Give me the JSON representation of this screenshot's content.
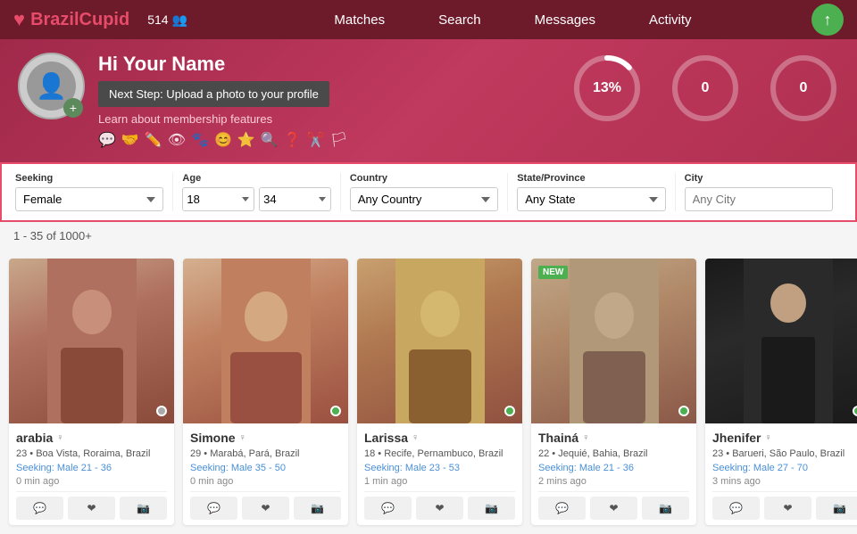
{
  "header": {
    "logo_brazil": "Brazil",
    "logo_cupid": "Cupid",
    "notifications": "514",
    "nav": {
      "matches": "Matches",
      "search": "Search",
      "messages": "Messages",
      "activity": "Activity"
    }
  },
  "profile": {
    "greeting": "Hi Your Name",
    "next_step": "Next Step: Upload a photo to your profile",
    "membership_link": "Learn about membership features",
    "stats": {
      "percent": "13%",
      "matches": "0",
      "messages": "0"
    }
  },
  "filters": {
    "seeking_label": "Seeking",
    "seeking_value": "Female",
    "age_label": "Age",
    "age_min": "18",
    "age_max": "34",
    "country_label": "Country",
    "country_value": "Any Country",
    "state_label": "State/Province",
    "state_value": "Any State",
    "city_label": "City",
    "city_value": "Any City"
  },
  "results": {
    "count_label": "1 - 35 of 1000+"
  },
  "cards": [
    {
      "name": "arabia",
      "age": "23",
      "location": "Boa Vista, Roraima, Brazil",
      "seeking": "Seeking: Male 21 - 36",
      "time": "0 min ago",
      "online": false,
      "new": false
    },
    {
      "name": "Simone",
      "age": "29",
      "location": "Marabá, Pará, Brazil",
      "seeking": "Seeking: Male 35 - 50",
      "time": "0 min ago",
      "online": true,
      "new": false
    },
    {
      "name": "Larissa",
      "age": "18",
      "location": "Recife, Pernambuco, Brazil",
      "seeking": "Seeking: Male 23 - 53",
      "time": "1 min ago",
      "online": true,
      "new": false
    },
    {
      "name": "Thainá",
      "age": "22",
      "location": "Jequié, Bahia, Brazil",
      "seeking": "Seeking: Male 21 - 36",
      "time": "2 mins ago",
      "online": true,
      "new": true
    },
    {
      "name": "Jhenifer",
      "age": "23",
      "location": "Barueri, São Paulo, Brazil",
      "seeking": "Seeking: Male 27 - 70",
      "time": "3 mins ago",
      "online": true,
      "new": false
    }
  ],
  "icons": {
    "heart": "♥",
    "person": "👤",
    "camera": "📷",
    "message": "✉",
    "favorite": "★",
    "add": "+",
    "upload": "↑"
  }
}
